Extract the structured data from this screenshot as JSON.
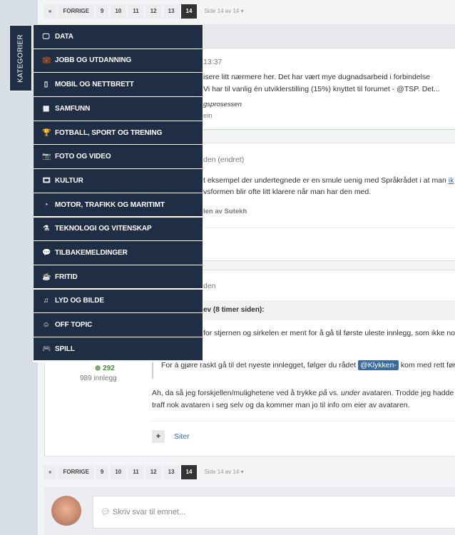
{
  "pagination": {
    "first": "«",
    "prev": "FORRIGE",
    "pages": [
      "9",
      "10",
      "11",
      "12",
      "13",
      "14"
    ],
    "current": "14",
    "page_label": "Side 14 av 14"
  },
  "sidebar_tab": "KATEGORIER",
  "categories": [
    {
      "label": "DATA",
      "icon": "monitor-icon",
      "glyph": "🖵"
    },
    {
      "label": "JOBB OG UTDANNING",
      "icon": "briefcase-icon",
      "glyph": "💼"
    },
    {
      "label": "MOBIL OG NETTBRETT",
      "icon": "mobile-icon",
      "glyph": "▯"
    },
    {
      "label": "SAMFUNN",
      "icon": "building-icon",
      "glyph": "▦"
    },
    {
      "label": "FOTBALL, SPORT OG TRENING",
      "icon": "trophy-icon",
      "glyph": "🏆"
    },
    {
      "label": "FOTO OG VIDEO",
      "icon": "camera-icon",
      "glyph": "📷"
    },
    {
      "label": "KULTUR",
      "icon": "film-icon",
      "glyph": "🎞"
    },
    {
      "label": "MOTOR, TRAFIKK OG MARITIMT",
      "icon": "dashboard-icon",
      "glyph": "◔"
    },
    {
      "label": "TEKNOLOGI OG VITENSKAP",
      "icon": "flask-icon",
      "glyph": "⚗"
    },
    {
      "label": "TILBAKEMELDINGER",
      "icon": "comments-icon",
      "glyph": "💬"
    },
    {
      "label": "FRITID",
      "icon": "coffee-icon",
      "glyph": "☕"
    },
    {
      "label": "LYD OG BILDE",
      "icon": "music-icon",
      "glyph": "♫"
    },
    {
      "label": "OFF TOPIC",
      "icon": "smile-icon",
      "glyph": "☺"
    },
    {
      "label": "SPILL",
      "icon": "gamepad-icon",
      "glyph": "🎮"
    }
  ],
  "post1": {
    "time": "13:37",
    "line1": "isere litt nærmere her. Det har vært mye dugnadsarbeid i forbindelse",
    "line2": "Vi har til vanlig én utviklerstilling (15%) knyttet til forumet - @TSP. Det...",
    "italic": "gsprosessen",
    "sub": "ein"
  },
  "post2": {
    "time": "den (endret)",
    "line1": "t eksempel der undertegnede er en smule uenig med Språkrådet i at man",
    "link": "ik",
    "line2": "vsformen blir ofte litt klarere når man har den med.",
    "edited": "len av Sutekh"
  },
  "post3": {
    "time": "den",
    "quote_header": "ev (8 timer siden):",
    "quote1": "for stjernen og sirkelen er ment for å gå til første uleste innlegg, som ikke no",
    "quote2_pre": "For å gjøre raskt gå til det nyeste innlegget, følger du rådet",
    "mention": "@Klykken-",
    "quote2_post": "kom med rett før",
    "reputation": "292",
    "posts": "989 innlegg",
    "body1_a": "Ah, da så jeg forskjellen/mulighetene ved å trykke ",
    "body1_i1": "på",
    "body1_b": " vs. ",
    "body1_i2": "under",
    "body1_c": " avataren. Trodde jeg hadde",
    "body2": "traff nok avataren i seg selv og da kommer man jo til info om eier av avataren.",
    "plus": "+",
    "quote_btn": "Siter"
  },
  "reply": {
    "placeholder": "Skriv svar til emnet..."
  }
}
